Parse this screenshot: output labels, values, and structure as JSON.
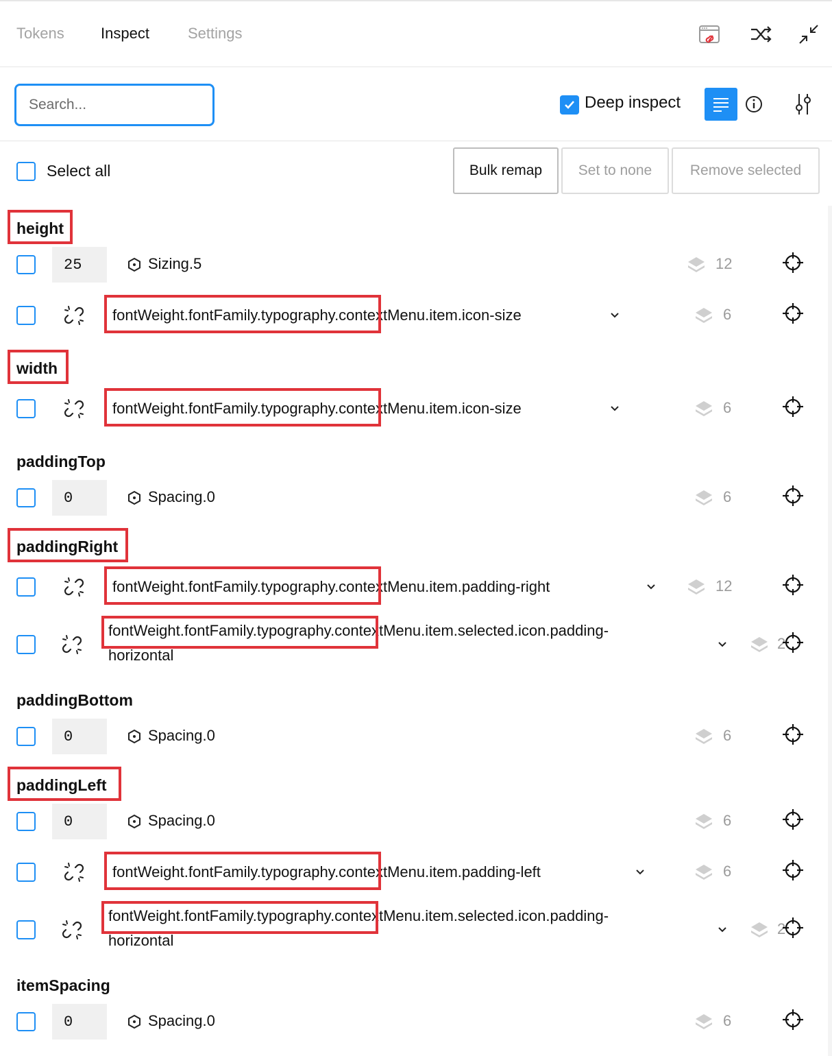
{
  "tabs": [
    {
      "label": "Tokens",
      "active": false
    },
    {
      "label": "Inspect",
      "active": true
    },
    {
      "label": "Settings",
      "active": false
    }
  ],
  "header_icons": [
    "calendar-broken-link-icon",
    "shuffle-icon",
    "minimize-icon"
  ],
  "toolbar": {
    "search_placeholder": "Search...",
    "search_value": "",
    "deep_inspect_label": "Deep inspect",
    "deep_inspect_checked": true,
    "icons": [
      "list-view-icon",
      "info-icon",
      "settings-sliders-icon"
    ]
  },
  "bulk": {
    "select_all_label": "Select all",
    "bulk_remap_label": "Bulk remap",
    "set_to_none_label": "Set to none",
    "remove_selected_label": "Remove selected"
  },
  "colors": {
    "accent": "#1e8ff5",
    "highlight": "#e0333a",
    "muted": "#9b9b9b"
  },
  "groups": [
    {
      "name": "height",
      "highlighted": true,
      "rows": [
        {
          "type": "resolved",
          "value": "25",
          "token": "Sizing.5",
          "count": "12"
        },
        {
          "type": "broken",
          "prefix": "fontWeight.fontFamily.typography",
          "suffix": ".contextMenu.item.icon-size",
          "count": "6"
        }
      ]
    },
    {
      "name": "width",
      "highlighted": true,
      "rows": [
        {
          "type": "broken",
          "prefix": "fontWeight.fontFamily.typography",
          "suffix": ".contextMenu.item.icon-size",
          "count": "6"
        }
      ]
    },
    {
      "name": "paddingTop",
      "highlighted": false,
      "rows": [
        {
          "type": "resolved",
          "value": "0",
          "token": "Spacing.0",
          "count": "6"
        }
      ]
    },
    {
      "name": "paddingRight",
      "highlighted": true,
      "rows": [
        {
          "type": "broken",
          "prefix": "fontWeight.fontFamily.typography",
          "suffix": ".contextMenu.item.padding-right",
          "count": "12"
        },
        {
          "type": "broken",
          "prefix": "fontWeight.fontFamily.typography",
          "suffix": ".contextMenu.item.selected.icon.padding-",
          "suffix2": "horizontal",
          "count": "2"
        }
      ]
    },
    {
      "name": "paddingBottom",
      "highlighted": false,
      "rows": [
        {
          "type": "resolved",
          "value": "0",
          "token": "Spacing.0",
          "count": "6"
        }
      ]
    },
    {
      "name": "paddingLeft",
      "highlighted": true,
      "rows": [
        {
          "type": "resolved",
          "value": "0",
          "token": "Spacing.0",
          "count": "6"
        },
        {
          "type": "broken",
          "prefix": "fontWeight.fontFamily.typography",
          "suffix": ".contextMenu.item.padding-left",
          "count": "6"
        },
        {
          "type": "broken",
          "prefix": "fontWeight.fontFamily.typography",
          "suffix": ".contextMenu.item.selected.icon.padding-",
          "suffix2": "horizontal",
          "count": "2"
        }
      ]
    },
    {
      "name": "itemSpacing",
      "highlighted": false,
      "rows": [
        {
          "type": "resolved",
          "value": "0",
          "token": "Spacing.0",
          "count": "6"
        }
      ]
    }
  ]
}
